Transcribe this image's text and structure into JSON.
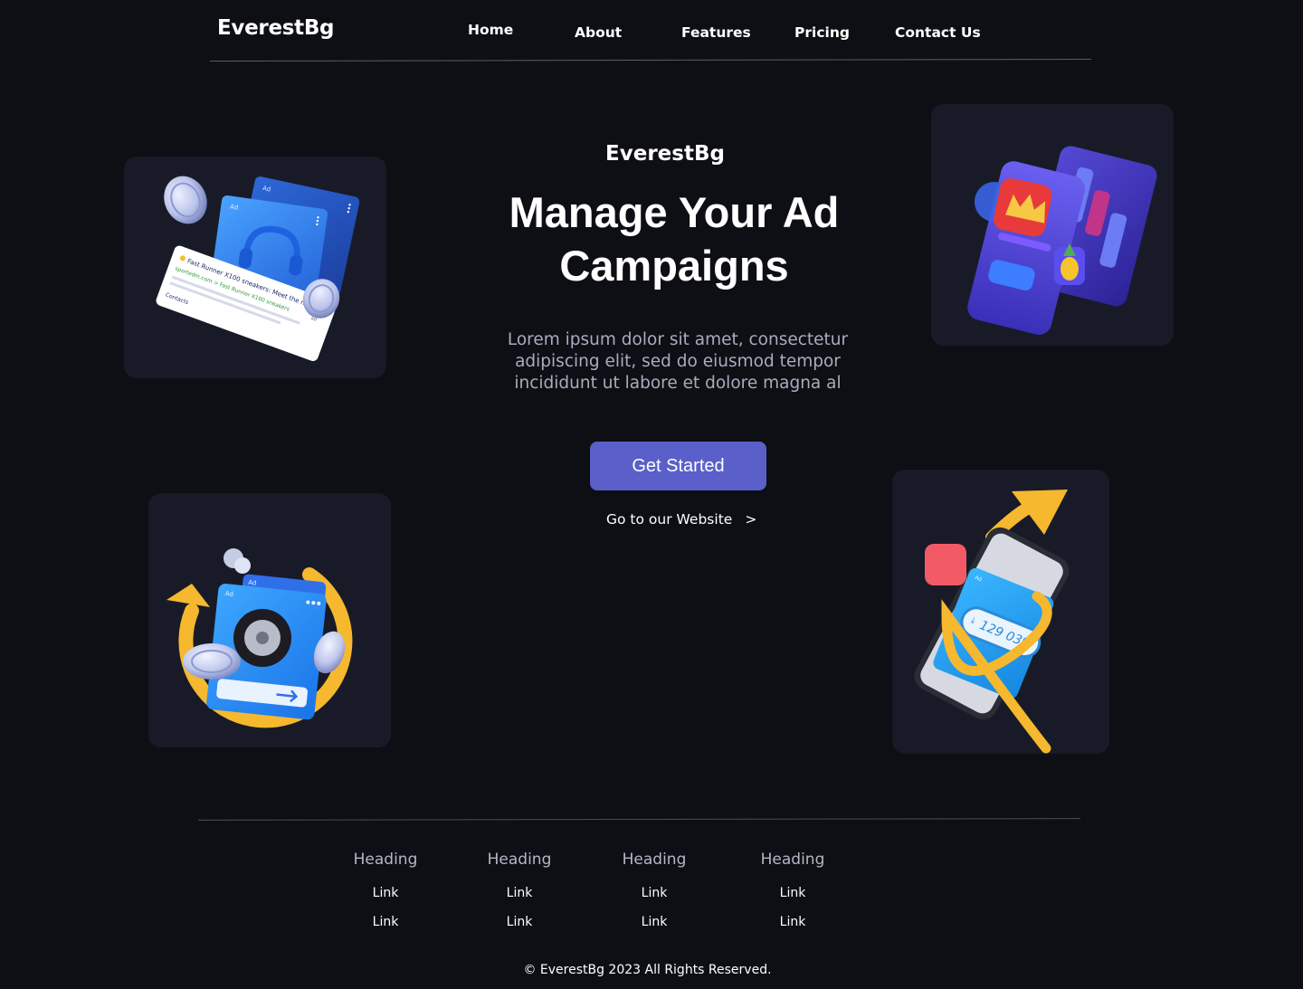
{
  "brand": "EverestBg",
  "nav": {
    "items": [
      {
        "label": "Home"
      },
      {
        "label": "About"
      },
      {
        "label": "Features"
      },
      {
        "label": "Pricing"
      },
      {
        "label": "Contact Us"
      }
    ]
  },
  "hero": {
    "brand": "EverestBg",
    "title": "Manage Your Ad Campaigns",
    "description": "Lorem ipsum dolor sit amet, consectetur adipiscing elit, sed do eiusmod tempor incididunt ut labore et dolore magna al",
    "cta_label": "Get Started",
    "website_link_label": "Go to our Website",
    "website_link_arrow": ">"
  },
  "cards": {
    "search_ad": {
      "ad_tag_1": "Ad",
      "ad_tag_2": "Ad",
      "result_title": "Fast Runner X100 sneakers: Meet the new seaso",
      "result_url": "sportedm.com > Fast Runner X100 sneakers",
      "result_badge": "ad",
      "result_link": "Contacts"
    },
    "tire_ad": {
      "ad_tag_1": "Ad",
      "ad_tag_2": "Ad"
    },
    "phone_download": {
      "ad_tag": "Ad",
      "count": "129 039"
    }
  },
  "footer": {
    "columns": [
      {
        "heading": "Heading",
        "links": [
          "Link",
          "Link"
        ]
      },
      {
        "heading": "Heading",
        "links": [
          "Link",
          "Link"
        ]
      },
      {
        "heading": "Heading",
        "links": [
          "Link",
          "Link"
        ]
      },
      {
        "heading": "Heading",
        "links": [
          "Link",
          "Link"
        ]
      }
    ],
    "copyright": "© EverestBg 2023 All Rights Reserved."
  },
  "colors": {
    "background": "#0d0f15",
    "card": "#181b27",
    "accent_button": "#5a5fc9",
    "muted_text": "#a9acbc",
    "illustration_blue": "#2f8ff0",
    "illustration_yellow": "#f5b82e",
    "illustration_purple": "#4a3fc4"
  }
}
